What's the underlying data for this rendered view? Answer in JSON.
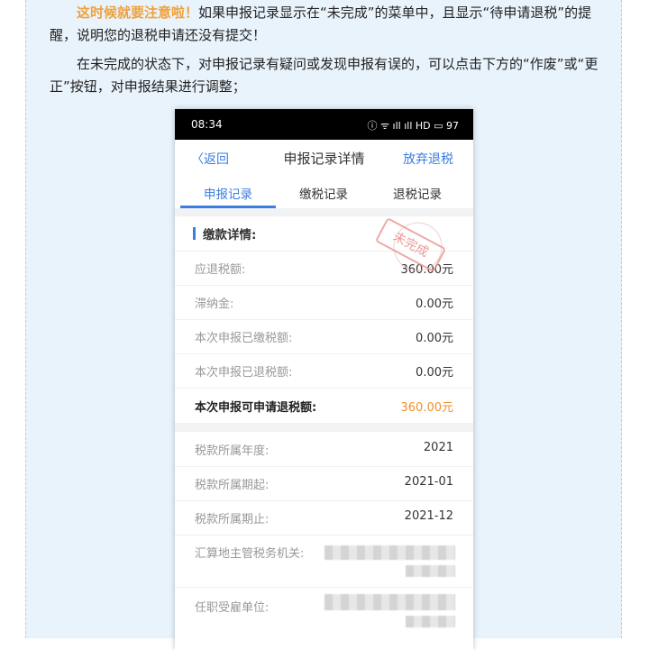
{
  "article": {
    "p1_highlight": "这时候就要注意啦！",
    "p1_rest": "如果申报记录显示在“未完成”的菜单中，且显示“待申请退税”的提醒，说明您的退税申请还没有提交！",
    "p2": "在未完成的状态下，对申报记录有疑问或发现申报有误的，可以点击下方的“作废”或“更正”按钮，对申报结果进行调整；"
  },
  "phone": {
    "status": {
      "time": "08:34",
      "icons": "ⓘ ᯤ ıll ıll HD ▭ 97"
    },
    "nav": {
      "back": "返回",
      "title": "申报记录详情",
      "action": "放弃退税"
    },
    "tabs": [
      "申报记录",
      "缴税记录",
      "退税记录"
    ],
    "stamp": "未完成",
    "section_title": "缴款详情:",
    "rows": [
      {
        "label": "应退税额:",
        "value": "360.00元"
      },
      {
        "label": "滞纳金:",
        "value": "0.00元"
      },
      {
        "label": "本次申报已缴税额:",
        "value": "0.00元"
      },
      {
        "label": "本次申报已退税额:",
        "value": "0.00元"
      }
    ],
    "total": {
      "label": "本次申报可申请退税额:",
      "value": "360.00元"
    },
    "info_rows": [
      {
        "label": "税款所属年度:",
        "value": "2021"
      },
      {
        "label": "税款所属期起:",
        "value": "2021-01"
      },
      {
        "label": "税款所属期止:",
        "value": "2021-12"
      }
    ],
    "agency_label": "汇算地主管税务机关:",
    "employer_label": "任职受雇单位:"
  },
  "colors": {
    "accent": "#3b7de0",
    "highlight": "#f0a13a",
    "amount": "#f0902d"
  }
}
